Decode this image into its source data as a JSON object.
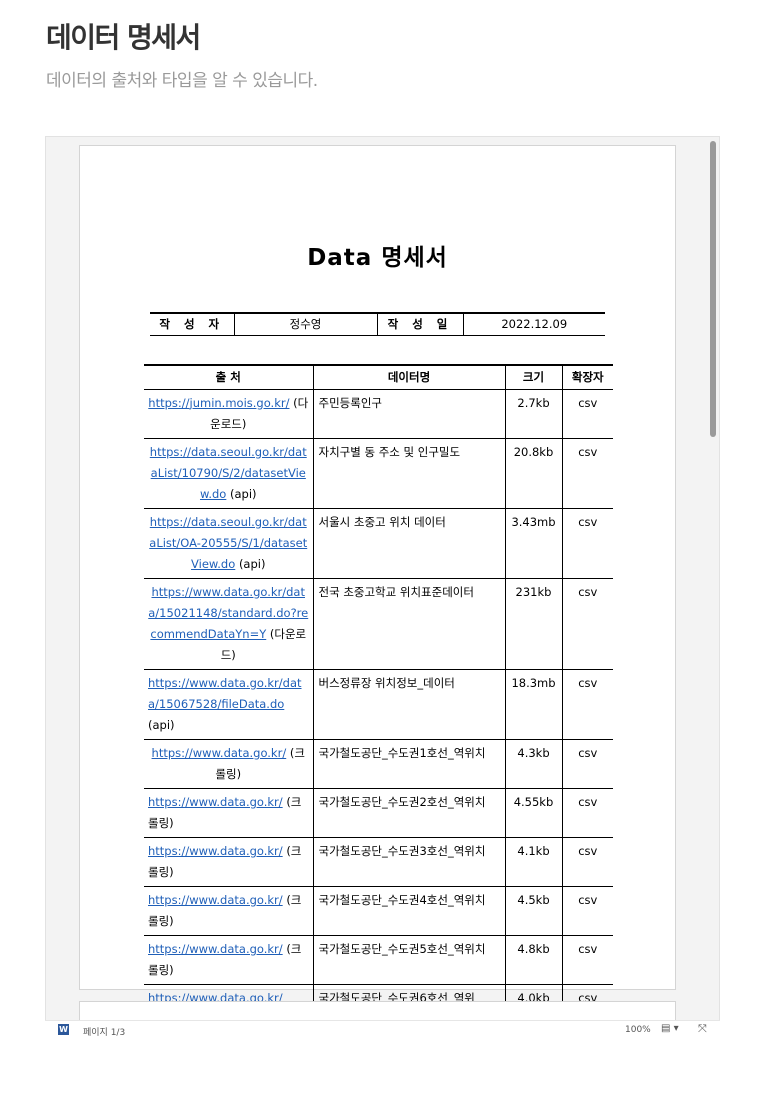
{
  "header": {
    "title": "데이터 명세서",
    "subtitle": "데이터의 출처와 타입을 알 수 있습니다."
  },
  "document": {
    "title": "Data  명세서",
    "author": {
      "author_label": "작 성 자",
      "author_value": "정수영",
      "date_label": "작 성 일",
      "date_value": "2022.12.09"
    },
    "table_headers": {
      "source": "출 처",
      "name": "데이터명",
      "size": "크기",
      "ext": "확장자"
    },
    "rows": [
      {
        "url": "https://jumin.mois.go.kr/",
        "note": "(다운로드)",
        "name": "주민등록인구",
        "size": "2.7kb",
        "ext": "csv"
      },
      {
        "url": "https://data.seoul.go.kr/dataList/10790/S/2/datasetView.do",
        "note": "(api)",
        "name": "자치구별 동 주소 및 인구밀도",
        "size": "20.8kb",
        "ext": "csv"
      },
      {
        "url": "https://data.seoul.go.kr/dataList/OA-20555/S/1/datasetView.do",
        "note": "(api)",
        "name": "서울시 초중고 위치 데이터",
        "size": "3.43mb",
        "ext": "csv"
      },
      {
        "url": "https://www.data.go.kr/data/15021148/standard.do?recommendDataYn=Y",
        "note": "(다운로드)",
        "name": "전국 초중고학교 위치표준데이터",
        "size": "231kb",
        "ext": "csv"
      },
      {
        "url": "https://www.data.go.kr/data/15067528/fileData.do",
        "note": "(api)",
        "name": "버스정류장 위치정보_데이터",
        "size": "18.3mb",
        "ext": "csv"
      },
      {
        "url": "https://www.data.go.kr/",
        "note": "(크롤링)",
        "name": "국가철도공단_수도권1호선_역위치",
        "size": "4.3kb",
        "ext": "csv"
      },
      {
        "url": "https://www.data.go.kr/",
        "note": "(크롤링)",
        "name": "국가철도공단_수도권2호선_역위치",
        "size": "4.55kb",
        "ext": "csv"
      },
      {
        "url": "https://www.data.go.kr/",
        "note": "(크롤링)",
        "name": "국가철도공단_수도권3호선_역위치",
        "size": "4.1kb",
        "ext": "csv"
      },
      {
        "url": "https://www.data.go.kr/",
        "note": "(크롤링)",
        "name": "국가철도공단_수도권4호선_역위치",
        "size": "4.5kb",
        "ext": "csv"
      },
      {
        "url": "https://www.data.go.kr/",
        "note": "(크롤링)",
        "name": "국가철도공단_수도권5호선_역위치",
        "size": "4.8kb",
        "ext": "csv"
      },
      {
        "url": "https://www.data.go.kr/",
        "note": "",
        "name": "국가철도공단_수도권6호선_역위",
        "size": "4.0kb",
        "ext": "csv"
      }
    ]
  },
  "statusbar": {
    "app_icon": "word-icon",
    "page_indicator": "페이지 1/3",
    "zoom": "100%",
    "view_icon": "▤ ▾",
    "fit_icon": "⤧"
  }
}
